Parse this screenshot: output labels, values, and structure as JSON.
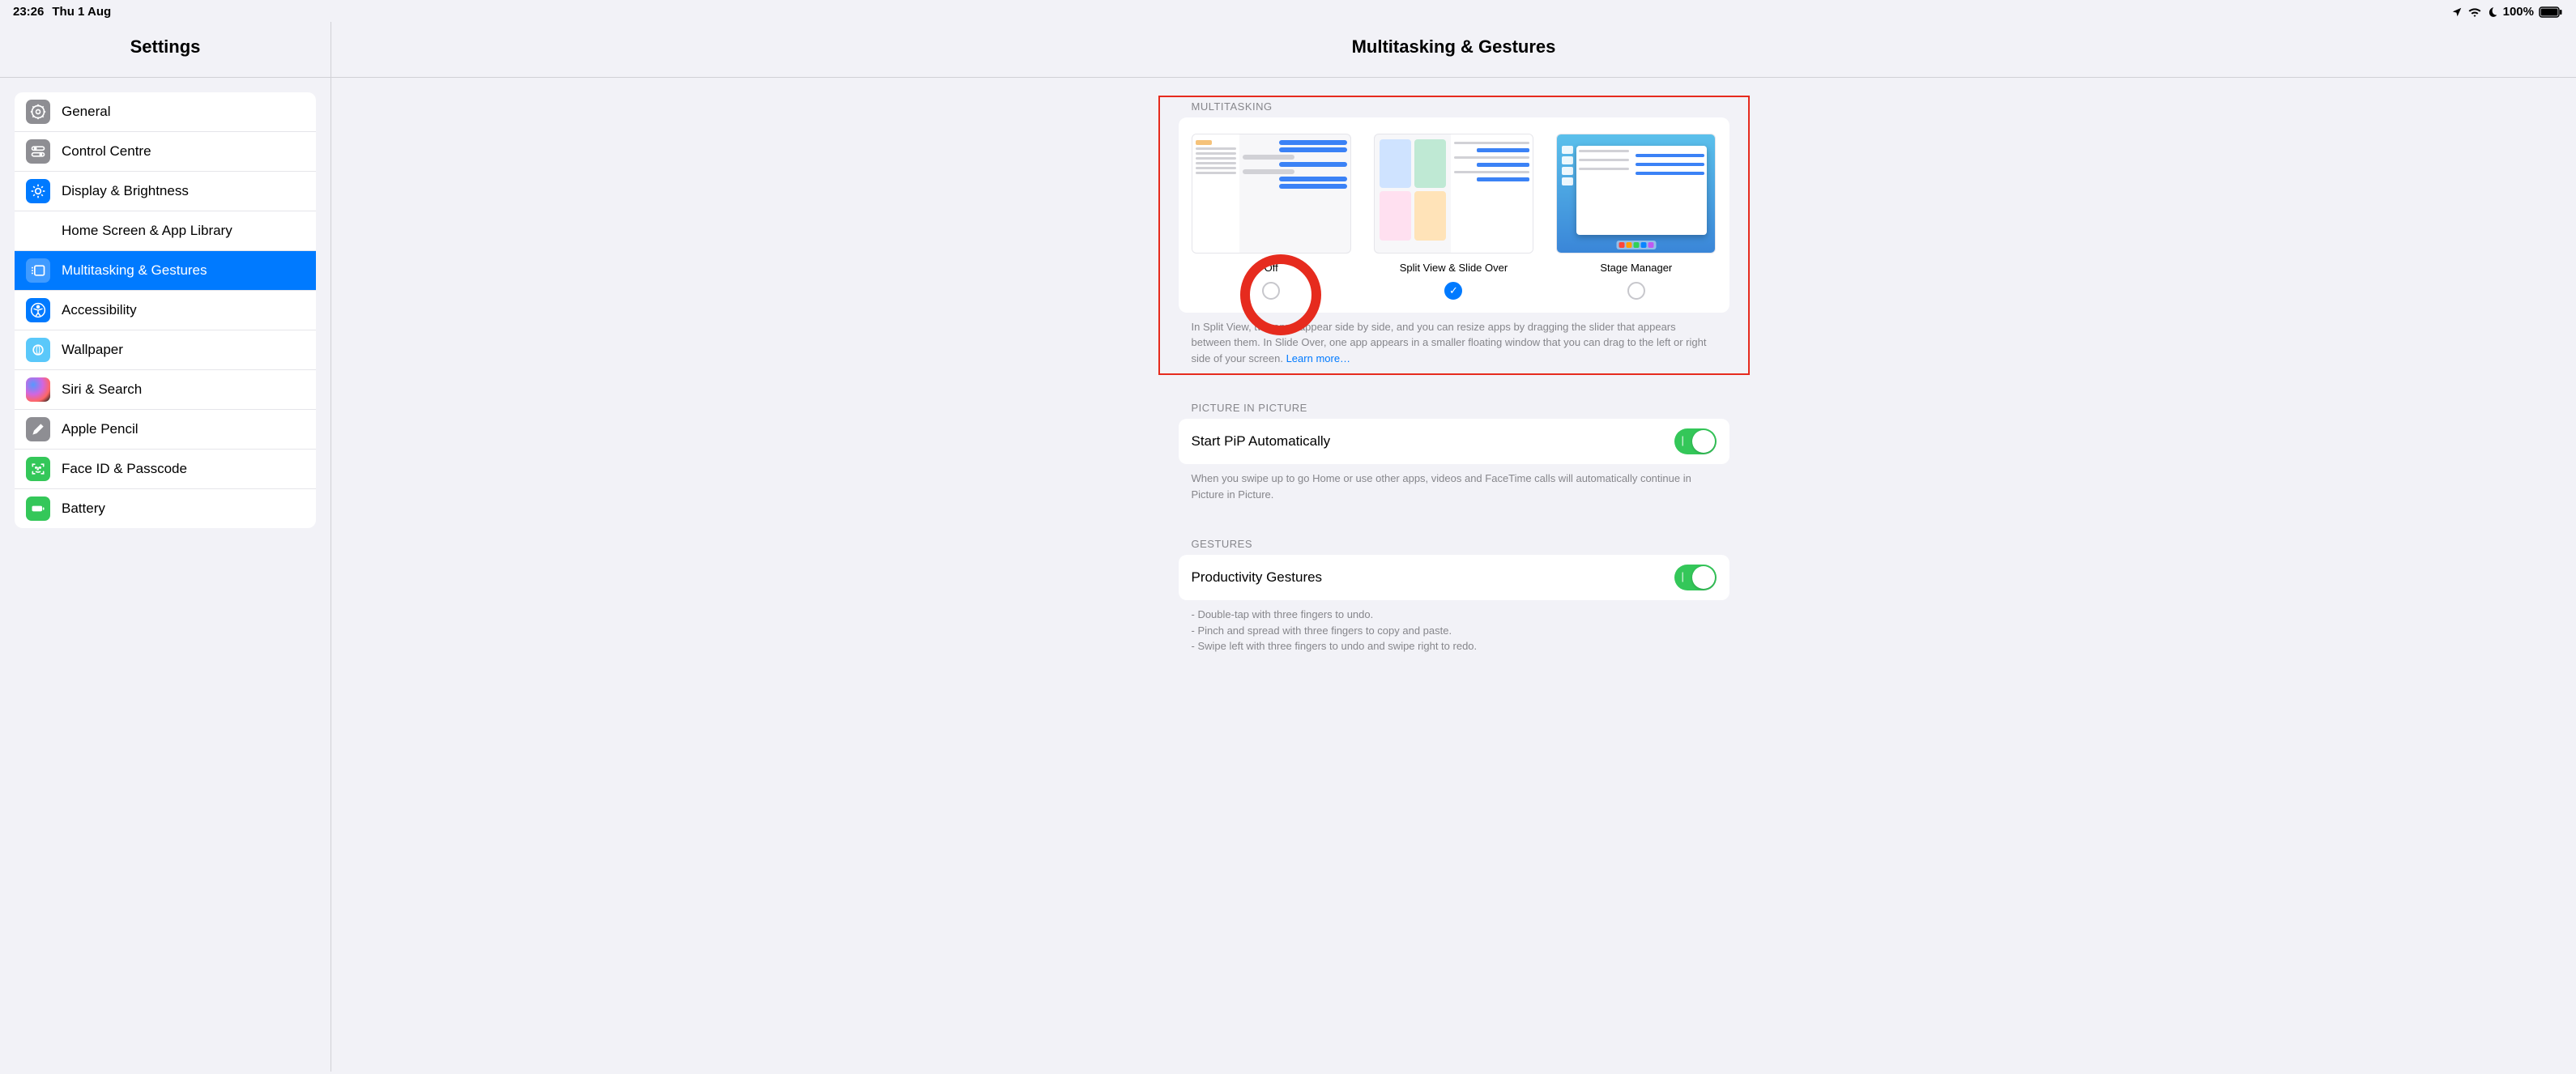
{
  "status": {
    "time": "23:26",
    "date": "Thu 1 Aug",
    "battery_pct": "100%"
  },
  "sidebar": {
    "title": "Settings",
    "items": [
      {
        "label": "General"
      },
      {
        "label": "Control Centre"
      },
      {
        "label": "Display & Brightness"
      },
      {
        "label": "Home Screen & App Library"
      },
      {
        "label": "Multitasking & Gestures"
      },
      {
        "label": "Accessibility"
      },
      {
        "label": "Wallpaper"
      },
      {
        "label": "Siri & Search"
      },
      {
        "label": "Apple Pencil"
      },
      {
        "label": "Face ID & Passcode"
      },
      {
        "label": "Battery"
      }
    ],
    "selected_index": 4
  },
  "main": {
    "title": "Multitasking & Gestures",
    "multitasking": {
      "header": "MULTITASKING",
      "options": [
        {
          "label": "Off",
          "checked": false
        },
        {
          "label": "Split View & Slide Over",
          "checked": true
        },
        {
          "label": "Stage Manager",
          "checked": false
        }
      ],
      "footer_text": "In Split View, two apps appear side by side, and you can resize apps by dragging the slider that appears between them. In Slide Over, one app appears in a smaller floating window that you can drag to the left or right side of your screen.",
      "footer_link": "Learn more…"
    },
    "pip": {
      "header": "PICTURE IN PICTURE",
      "row_label": "Start PiP Automatically",
      "toggle_on": true,
      "footer_text": "When you swipe up to go Home or use other apps, videos and FaceTime calls will automatically continue in Picture in Picture."
    },
    "gestures": {
      "header": "GESTURES",
      "row_label": "Productivity Gestures",
      "toggle_on": true,
      "footer_lines": [
        "- Double-tap with three fingers to undo.",
        "- Pinch and spread with three fingers to copy and paste.",
        "- Swipe left with three fingers to undo and swipe right to redo."
      ]
    }
  }
}
